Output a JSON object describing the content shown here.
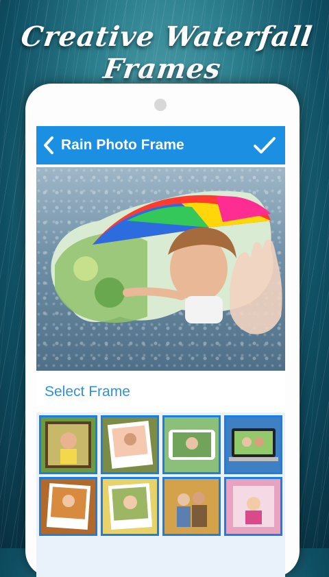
{
  "promo": {
    "title": "Creative Waterfall Frames"
  },
  "appbar": {
    "title": "Rain Photo Frame",
    "back_icon": "chevron-left-icon",
    "confirm_icon": "check-icon"
  },
  "editor": {
    "section_label": "Select Frame"
  },
  "frames": [
    {
      "name": "frame-1",
      "theme": "green-flower"
    },
    {
      "name": "frame-2",
      "theme": "white-polaroid"
    },
    {
      "name": "frame-3",
      "theme": "phone-mockup"
    },
    {
      "name": "frame-4",
      "theme": "laptop-mockup"
    },
    {
      "name": "frame-5",
      "theme": "autumn"
    },
    {
      "name": "frame-6",
      "theme": "sunlight-polaroid"
    },
    {
      "name": "frame-7",
      "theme": "family"
    },
    {
      "name": "frame-8",
      "theme": "pink-flowers"
    }
  ],
  "colors": {
    "appbar": "#1b8fe2",
    "accent_text": "#2c93d8",
    "thumb_border": "#1a7fe0"
  }
}
